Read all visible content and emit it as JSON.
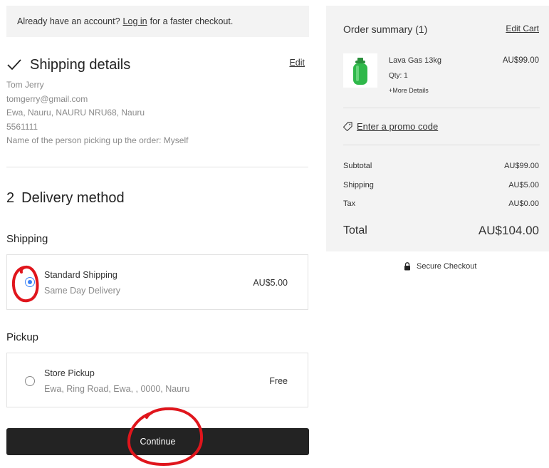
{
  "login_banner": {
    "prefix": "Already have an account?",
    "link": "Log in",
    "suffix": "for a faster checkout."
  },
  "shipping_details": {
    "title": "Shipping details",
    "edit_label": "Edit",
    "name": "Tom Jerry",
    "email": "tomgerry@gmail.com",
    "address": "Ewa, Nauru, NAURU NRU68, Nauru",
    "phone": "5561111",
    "pickup_person": "Name of the person picking up the order: Myself"
  },
  "delivery": {
    "step_number": "2",
    "title": "Delivery method",
    "shipping_group_label": "Shipping",
    "pickup_group_label": "Pickup",
    "options": [
      {
        "name": "Standard Shipping",
        "sub": "Same Day Delivery",
        "price": "AU$5.00",
        "selected": true
      },
      {
        "name": "Store Pickup",
        "sub": "Ewa, Ring Road, Ewa, , 0000, Nauru",
        "price": "Free",
        "selected": false
      }
    ],
    "continue_label": "Continue"
  },
  "order_summary": {
    "title": "Order summary (1)",
    "edit_cart_label": "Edit Cart",
    "item": {
      "name": "Lava Gas 13kg",
      "price": "AU$99.00",
      "qty": "Qty: 1",
      "more_details": "+More Details"
    },
    "promo_label": "Enter a promo code",
    "rows": [
      {
        "label": "Subtotal",
        "value": "AU$99.00"
      },
      {
        "label": "Shipping",
        "value": "AU$5.00"
      },
      {
        "label": "Tax",
        "value": "AU$0.00"
      }
    ],
    "total_label": "Total",
    "total_value": "AU$104.00"
  },
  "secure_checkout_label": "Secure Checkout",
  "colors": {
    "panel_bg": "#f3f3f3",
    "button_bg": "#232323",
    "radio_selected": "#3b82f6",
    "annotation_red": "#e0151c",
    "product_green": "#2fb84a"
  },
  "icons": [
    "checkmark-icon",
    "tag-icon",
    "lock-icon",
    "gas-cylinder-image"
  ]
}
